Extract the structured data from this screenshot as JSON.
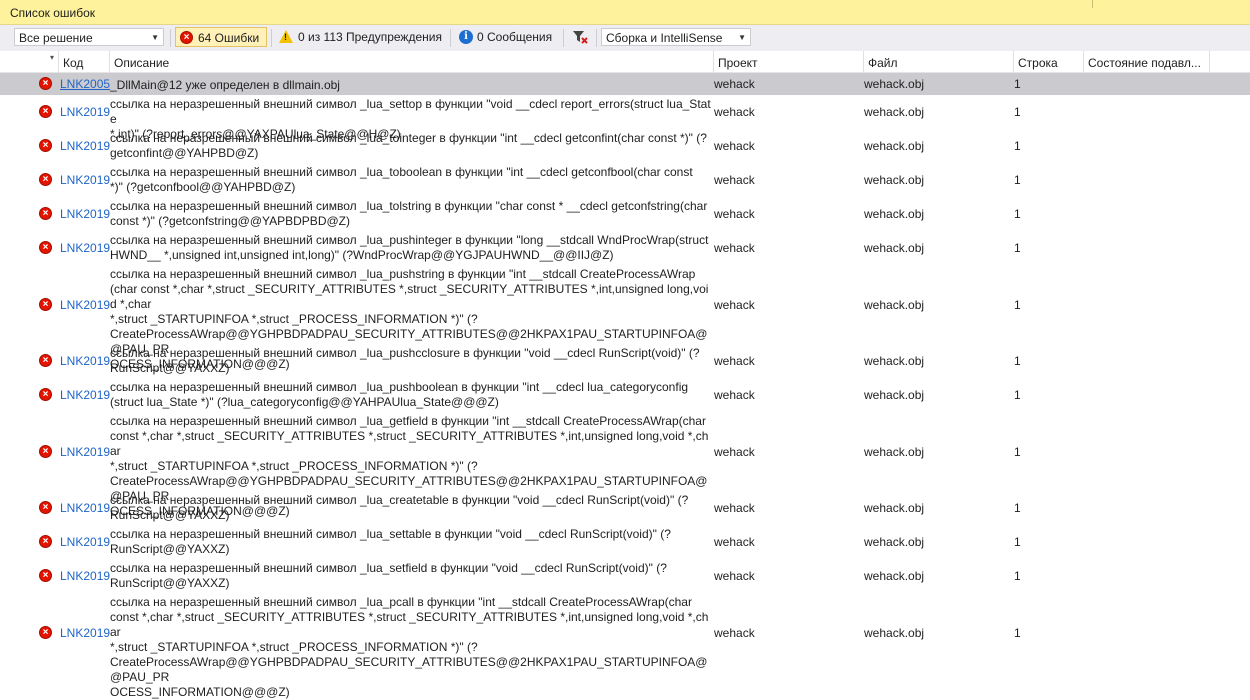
{
  "window": {
    "title": "Список ошибок"
  },
  "toolbar": {
    "scope": {
      "value": "Все решение"
    },
    "errors_btn": {
      "label": "64 Ошибки",
      "active": true
    },
    "warnings_btn": {
      "label": "0 из 113 Предупреждения"
    },
    "messages_btn": {
      "label": "0 Сообщения"
    },
    "filter_icon": "filter-clear-icon",
    "build_source": {
      "value": "Сборка и IntelliSense"
    }
  },
  "columns": {
    "code": "Код",
    "description": "Описание",
    "project": "Проект",
    "file": "Файл",
    "line": "Строка",
    "suppression": "Состояние подавл..."
  },
  "colors": {
    "error": "#e51400",
    "link": "#1e64c8",
    "accent_bar": "#fff29d",
    "selected": "#cbcbcf"
  },
  "rows": [
    {
      "code": "LNK2005",
      "desc": "_DllMain@12 уже определен в dllmain.obj",
      "project": "wehack",
      "file": "wehack.obj",
      "line": "1"
    },
    {
      "code": "LNK2019",
      "desc": "ссылка на неразрешенный внешний символ _lua_settop в функции \"void __cdecl report_errors(struct lua_State\n*,int)\" (?report_errors@@YAXPAUlua_State@@H@Z)",
      "project": "wehack",
      "file": "wehack.obj",
      "line": "1"
    },
    {
      "code": "LNK2019",
      "desc": "ссылка на неразрешенный внешний символ _lua_tointeger в функции \"int __cdecl getconfint(char const *)\" (?\ngetconfint@@YAHPBD@Z)",
      "project": "wehack",
      "file": "wehack.obj",
      "line": "1"
    },
    {
      "code": "LNK2019",
      "desc": "ссылка на неразрешенный внешний символ _lua_toboolean в функции \"int __cdecl getconfbool(char const\n*)\" (?getconfbool@@YAHPBD@Z)",
      "project": "wehack",
      "file": "wehack.obj",
      "line": "1"
    },
    {
      "code": "LNK2019",
      "desc": "ссылка на неразрешенный внешний символ _lua_tolstring в функции \"char const * __cdecl getconfstring(char\nconst *)\" (?getconfstring@@YAPBDPBD@Z)",
      "project": "wehack",
      "file": "wehack.obj",
      "line": "1"
    },
    {
      "code": "LNK2019",
      "desc": "ссылка на неразрешенный внешний символ _lua_pushinteger в функции \"long __stdcall WndProcWrap(struct\nHWND__ *,unsigned int,unsigned int,long)\" (?WndProcWrap@@YGJPAUHWND__@@IIJ@Z)",
      "project": "wehack",
      "file": "wehack.obj",
      "line": "1"
    },
    {
      "code": "LNK2019",
      "desc": "ссылка на неразрешенный внешний символ _lua_pushstring в функции \"int __stdcall CreateProcessAWrap\n(char const *,char *,struct _SECURITY_ATTRIBUTES *,struct _SECURITY_ATTRIBUTES *,int,unsigned long,void *,char\n*,struct _STARTUPINFOA *,struct _PROCESS_INFORMATION *)\" (?\nCreateProcessAWrap@@YGHPBDPADPAU_SECURITY_ATTRIBUTES@@2HKPAX1PAU_STARTUPINFOA@@PAU_PR\nOCESS_INFORMATION@@@Z)",
      "project": "wehack",
      "file": "wehack.obj",
      "line": "1"
    },
    {
      "code": "LNK2019",
      "desc": "ссылка на неразрешенный внешний символ _lua_pushcclosure в функции \"void __cdecl RunScript(void)\" (?\nRunScript@@YAXXZ)",
      "project": "wehack",
      "file": "wehack.obj",
      "line": "1"
    },
    {
      "code": "LNK2019",
      "desc": "ссылка на неразрешенный внешний символ _lua_pushboolean в функции \"int __cdecl lua_categoryconfig\n(struct lua_State *)\" (?lua_categoryconfig@@YAHPAUlua_State@@@Z)",
      "project": "wehack",
      "file": "wehack.obj",
      "line": "1"
    },
    {
      "code": "LNK2019",
      "desc": "ссылка на неразрешенный внешний символ _lua_getfield в функции \"int __stdcall CreateProcessAWrap(char\nconst *,char *,struct _SECURITY_ATTRIBUTES *,struct _SECURITY_ATTRIBUTES *,int,unsigned long,void *,char\n*,struct _STARTUPINFOA *,struct _PROCESS_INFORMATION *)\" (?\nCreateProcessAWrap@@YGHPBDPADPAU_SECURITY_ATTRIBUTES@@2HKPAX1PAU_STARTUPINFOA@@PAU_PR\nOCESS_INFORMATION@@@Z)",
      "project": "wehack",
      "file": "wehack.obj",
      "line": "1"
    },
    {
      "code": "LNK2019",
      "desc": "ссылка на неразрешенный внешний символ _lua_createtable в функции \"void __cdecl RunScript(void)\" (?\nRunScript@@YAXXZ)",
      "project": "wehack",
      "file": "wehack.obj",
      "line": "1"
    },
    {
      "code": "LNK2019",
      "desc": "ссылка на неразрешенный внешний символ _lua_settable в функции \"void __cdecl RunScript(void)\" (?\nRunScript@@YAXXZ)",
      "project": "wehack",
      "file": "wehack.obj",
      "line": "1"
    },
    {
      "code": "LNK2019",
      "desc": "ссылка на неразрешенный внешний символ _lua_setfield в функции \"void __cdecl RunScript(void)\" (?\nRunScript@@YAXXZ)",
      "project": "wehack",
      "file": "wehack.obj",
      "line": "1"
    },
    {
      "code": "LNK2019",
      "desc": "ссылка на неразрешенный внешний символ _lua_pcall в функции \"int __stdcall CreateProcessAWrap(char\nconst *,char *,struct _SECURITY_ATTRIBUTES *,struct _SECURITY_ATTRIBUTES *,int,unsigned long,void *,char\n*,struct _STARTUPINFOA *,struct _PROCESS_INFORMATION *)\" (?\nCreateProcessAWrap@@YGHPBDPADPAU_SECURITY_ATTRIBUTES@@2HKPAX1PAU_STARTUPINFOA@@PAU_PR\nOCESS_INFORMATION@@@Z)",
      "project": "wehack",
      "file": "wehack.obj",
      "line": "1"
    }
  ]
}
